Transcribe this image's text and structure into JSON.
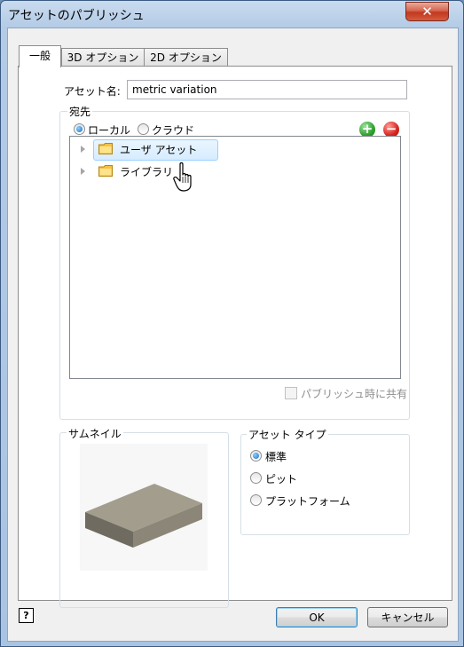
{
  "window": {
    "title": "アセットのパブリッシュ",
    "close_glyph": "✕"
  },
  "tabs": [
    {
      "label": "一般",
      "active": true
    },
    {
      "label": "3D オプション",
      "active": false
    },
    {
      "label": "2D オプション",
      "active": false
    }
  ],
  "asset_name": {
    "label": "アセット名:",
    "value": "metric variation"
  },
  "destination": {
    "title": "宛先",
    "radios": [
      {
        "label": "ローカル",
        "selected": true
      },
      {
        "label": "クラウド",
        "selected": false
      }
    ],
    "tree_items": [
      {
        "label": "ユーザ アセット",
        "selected": true
      },
      {
        "label": "ライブラリ",
        "selected": false
      }
    ],
    "share_checkbox": {
      "label": "パブリッシュ時に共有",
      "checked": false,
      "enabled": false
    }
  },
  "thumbnail": {
    "title": "サムネイル"
  },
  "asset_type": {
    "title": "アセット タイプ",
    "options": [
      {
        "label": "標準",
        "selected": true
      },
      {
        "label": "ピット",
        "selected": false
      },
      {
        "label": "プラットフォーム",
        "selected": false
      }
    ]
  },
  "footer": {
    "help_glyph": "?",
    "ok_label": "OK",
    "cancel_label": "キャンセル"
  },
  "colors": {
    "add_button": "#3cae3c",
    "remove_button": "#d6231e",
    "title_bar": "#b4cbe6"
  }
}
